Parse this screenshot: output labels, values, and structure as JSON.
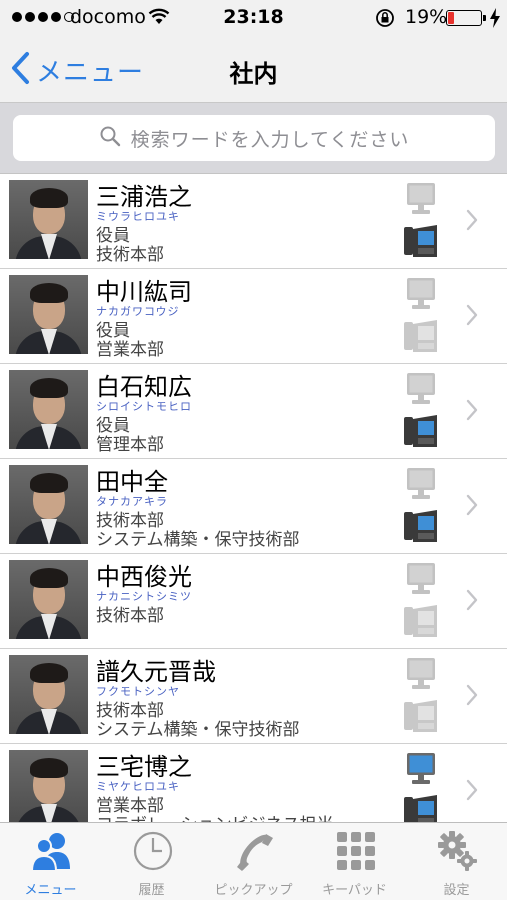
{
  "status_bar": {
    "carrier": "docomo",
    "time": "23:18",
    "battery_percent": "19%",
    "battery_level": 0.19,
    "battery_color": "#e8332e"
  },
  "nav": {
    "back_label": "メニュー",
    "title": "社内",
    "accent_color": "#2e7ee0"
  },
  "search": {
    "placeholder": "検索ワードを入力してください",
    "value": ""
  },
  "contacts": [
    {
      "name": "三浦浩之",
      "kana": "ミウラヒロユキ",
      "line1": "役員",
      "line2": "技術本部",
      "pc": "inactive",
      "phone": "active"
    },
    {
      "name": "中川紘司",
      "kana": "ナカガワコウジ",
      "line1": "役員",
      "line2": "営業本部",
      "pc": "inactive",
      "phone": "inactive"
    },
    {
      "name": "白石知広",
      "kana": "シロイシトモヒロ",
      "line1": "役員",
      "line2": "管理本部",
      "pc": "inactive",
      "phone": "active"
    },
    {
      "name": "田中全",
      "kana": "タナカアキラ",
      "line1": "技術本部",
      "line2": "システム構築・保守技術部",
      "pc": "inactive",
      "phone": "active"
    },
    {
      "name": "中西俊光",
      "kana": "ナカニシトシミツ",
      "line1": "技術本部",
      "line2": "",
      "pc": "inactive",
      "phone": "inactive"
    },
    {
      "name": "譜久元晋哉",
      "kana": "フクモトシンヤ",
      "line1": "技術本部",
      "line2": "システム構築・保守技術部",
      "pc": "inactive",
      "phone": "inactive"
    },
    {
      "name": "三宅博之",
      "kana": "ミヤケヒロユキ",
      "line1": "営業本部",
      "line2": "コラボレーションビジネス担当",
      "pc": "active",
      "phone": "active"
    }
  ],
  "tabs": [
    {
      "label": "メニュー",
      "icon": "people-icon",
      "active": true
    },
    {
      "label": "履歴",
      "icon": "clock-icon",
      "active": false
    },
    {
      "label": "ピックアップ",
      "icon": "handset-icon",
      "active": false
    },
    {
      "label": "キーパッド",
      "icon": "keypad-icon",
      "active": false
    },
    {
      "label": "設定",
      "icon": "gear-icon",
      "active": false
    }
  ]
}
